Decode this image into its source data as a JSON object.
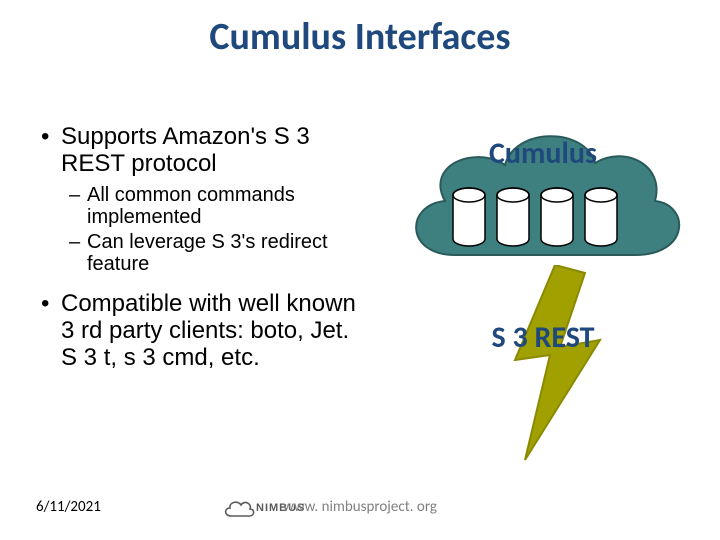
{
  "title": "Cumulus Interfaces",
  "bullets": {
    "p1": "Supports Amazon's S 3 REST protocol",
    "p1a": "All common commands implemented",
    "p1b": "Can leverage S 3's redirect feature",
    "p2": "Compatible with well known 3 rd party clients: boto, Jet. S 3 t, s 3 cmd, etc."
  },
  "diagram": {
    "cloud_label": "Cumulus",
    "s3_label": "S 3 REST"
  },
  "footer": {
    "date": "6/11/2021",
    "logo_text": "NIMBUS",
    "url": "www. nimbusproject. org"
  },
  "colors": {
    "title": "#1f497d",
    "cloud_fill": "#3e8080",
    "cloud_stroke": "#2a5a5a",
    "bolt_fill": "#a0a000",
    "bolt_stroke": "#8a8a00"
  }
}
